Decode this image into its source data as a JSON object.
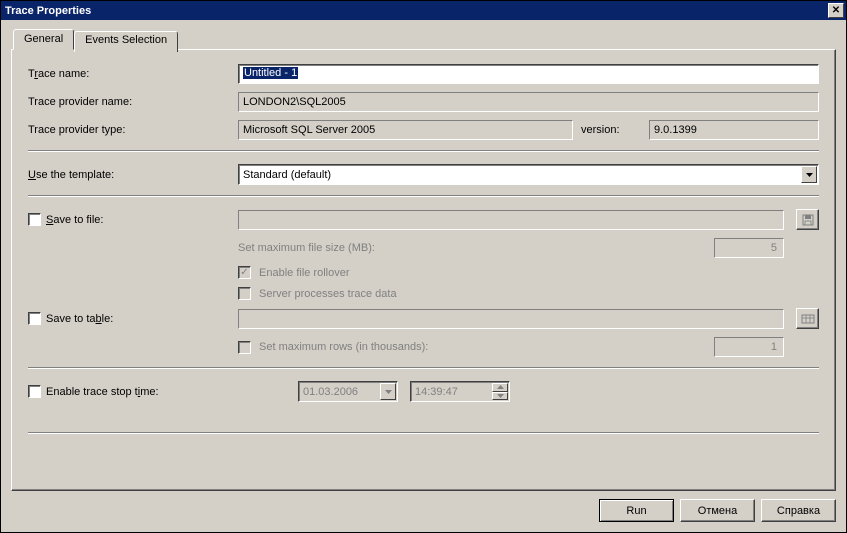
{
  "window": {
    "title": "Trace Properties"
  },
  "tabs": {
    "general": "General",
    "events": "Events Selection"
  },
  "labels": {
    "trace_name_pre": "T",
    "trace_name_u": "r",
    "trace_name_post": "ace name:",
    "provider_name": "Trace provider name:",
    "provider_type": "Trace provider type:",
    "version": "version:",
    "use_template_pre": "",
    "use_template_u": "U",
    "use_template_post": "se the template:",
    "save_file_pre": "",
    "save_file_u": "S",
    "save_file_post": "ave to file:",
    "max_file_size": "Set maximum file size (MB):",
    "enable_rollover_pre": "",
    "enable_rollover_u": "E",
    "enable_rollover_post": "nable file rollover",
    "server_processes_pre": "Ser",
    "server_processes_u": "v",
    "server_processes_post": "er processes trace data",
    "save_table_pre": "Save to ta",
    "save_table_u": "b",
    "save_table_post": "le:",
    "max_rows_pre": "Set maximum ro",
    "max_rows_u": "w",
    "max_rows_post": "s (in thousands):",
    "stop_time_pre": "Enable trace stop t",
    "stop_time_u": "i",
    "stop_time_post": "me:"
  },
  "values": {
    "trace_name": "Untitled - 1",
    "provider_name": "LONDON2\\SQL2005",
    "provider_type": "Microsoft SQL Server 2005",
    "version": "9.0.1399",
    "template": "Standard (default)",
    "max_file_size": "5",
    "max_rows": "1",
    "stop_date": "01.03.2006",
    "stop_time": "14:39:47"
  },
  "buttons": {
    "run_u": "R",
    "run_post": "un",
    "cancel": "Отмена",
    "help": "Справка"
  }
}
